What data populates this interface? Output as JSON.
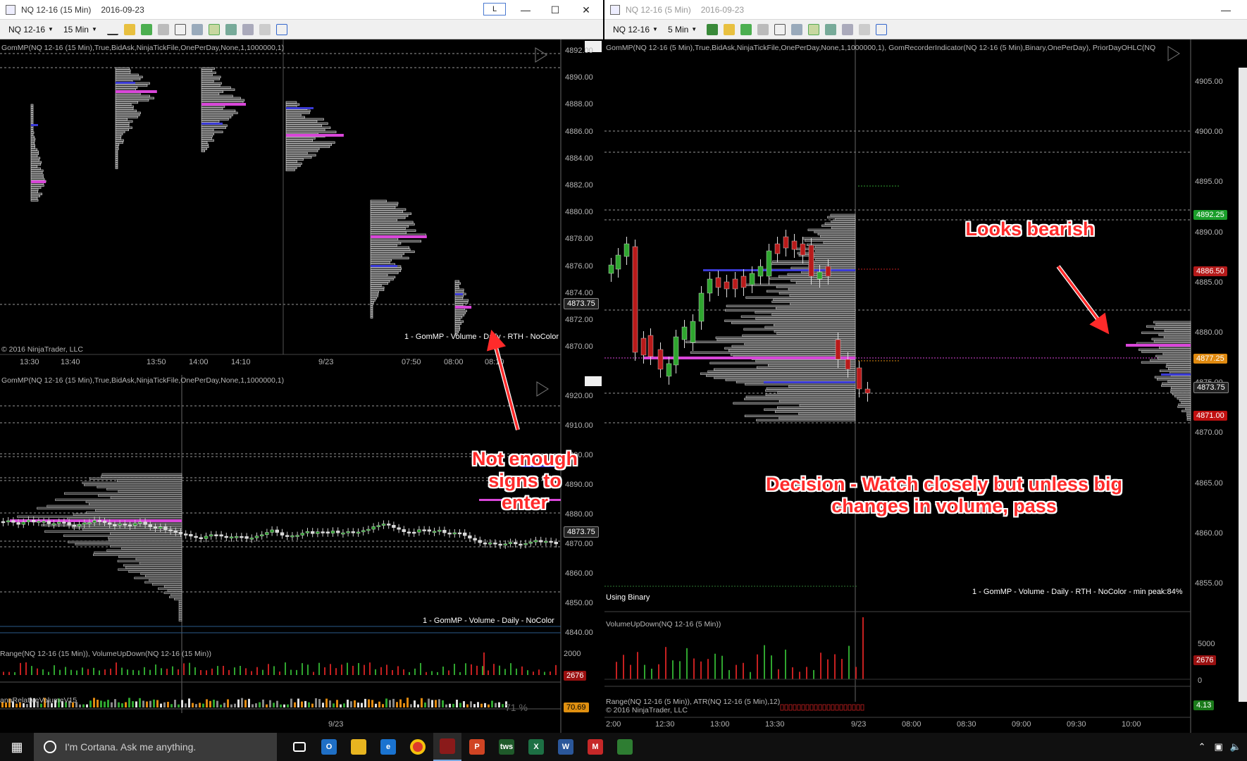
{
  "left_window": {
    "title": "NQ 12-16 (15 Min)",
    "date": "2016-09-23",
    "badge": "L",
    "instrument": "NQ 12-16",
    "interval": "15 Min",
    "top_panel": {
      "indicator_label": "GomMP(NQ 12-16 (15 Min),True,BidAsk,NinjaTickFile,OnePerDay,None,1,1000000,1)",
      "profile_label": "1 - GomMP - Volume - Daily - RTH - NoColor",
      "copyright": "© 2016 NinjaTrader, LLC",
      "y_labels": [
        "4892.00",
        "4890.00",
        "4888.00",
        "4886.00",
        "4884.00",
        "4882.00",
        "4880.00",
        "4878.00",
        "4876.00",
        "4874.00",
        "4872.00",
        "4870.00"
      ],
      "price_marker": "4873.75",
      "x_labels": [
        "13:30",
        "13:40",
        "13:50",
        "14:00",
        "14:10",
        "9/23",
        "07:50",
        "08:00",
        "08:10"
      ]
    },
    "bottom_panel": {
      "indicator_label": "GomMP(NQ 12-16 (15 Min),True,BidAsk,NinjaTickFile,OnePerDay,None,1,1000000,1)",
      "profile_label": "1 - GomMP - Volume - Daily - NoColor",
      "y_labels": [
        "4920.00",
        "4910.00",
        "4900.00",
        "4890.00",
        "4880.00",
        "4870.00",
        "4860.00",
        "4850.00",
        "4840.00"
      ],
      "price_marker": "4873.75",
      "range_label": "Range(NQ 12-16 (15 Min)), VolumeUpDown(NQ 12-16 (15 Min))",
      "range_value": "2676",
      "range_axis": "2000",
      "rel_vol_label": "anaRelativeVolumeV15",
      "rel_vol_pct": "71 %",
      "rel_vol_value": "70.69",
      "x_labels": [
        "9/23"
      ]
    }
  },
  "right_window": {
    "title": "NQ 12-16 (5 Min)",
    "date": "2016-09-23",
    "instrument": "NQ 12-16",
    "interval": "5 Min",
    "indicator_label": "GomMP(NQ 12-16 (5 Min),True,BidAsk,NinjaTickFile,OnePerDay,None,1,1000000,1), GomRecorderIndicator(NQ 12-16 (5 Min),Binary,OnePerDay), PriorDayOHLC(NQ",
    "using_binary": "Using Binary",
    "profile_label": "1 - GomMP - Volume - Daily - RTH - NoColor - min peak:84%",
    "y_labels": [
      "4905.00",
      "4900.00",
      "4895.00",
      "4890.00",
      "4885.00",
      "4880.00",
      "4875.00",
      "4870.00",
      "4865.00",
      "4860.00",
      "4855.00"
    ],
    "price_markers": [
      {
        "value": "4892.25",
        "color": "#1a9e2a"
      },
      {
        "value": "4886.50",
        "color": "#b51a1a"
      },
      {
        "value": "4877.25",
        "color": "#e08a10"
      },
      {
        "value": "4873.75",
        "color": "#222222"
      },
      {
        "value": "4871.00",
        "color": "#c01010"
      }
    ],
    "vol_label": "VolumeUpDown(NQ 12-16 (5 Min))",
    "vol_axis": [
      "5000",
      "0"
    ],
    "vol_value": "2676",
    "range_label": "Range(NQ 12-16 (5 Min)), ATR(NQ 12-16 (5 Min),12)",
    "range_value": "4.13",
    "copyright": "© 2016 NinjaTrader, LLC",
    "x_labels": [
      "2:00",
      "12:30",
      "13:00",
      "13:30",
      "9/23",
      "08:00",
      "08:30",
      "09:00",
      "09:30",
      "10:00"
    ]
  },
  "annotations": {
    "not_enough": "Not enough signs to enter",
    "bearish": "Looks bearish",
    "decision": "Decision - Watch closely but unless big changes in volume, pass"
  },
  "taskbar": {
    "cortana": "I'm Cortana. Ask me anything.",
    "apps": [
      "task-view",
      "outlook",
      "file-explorer",
      "edge",
      "chrome",
      "ninjatrader",
      "powerpoint",
      "tws",
      "excel",
      "word",
      "app-m",
      "app-green"
    ]
  }
}
